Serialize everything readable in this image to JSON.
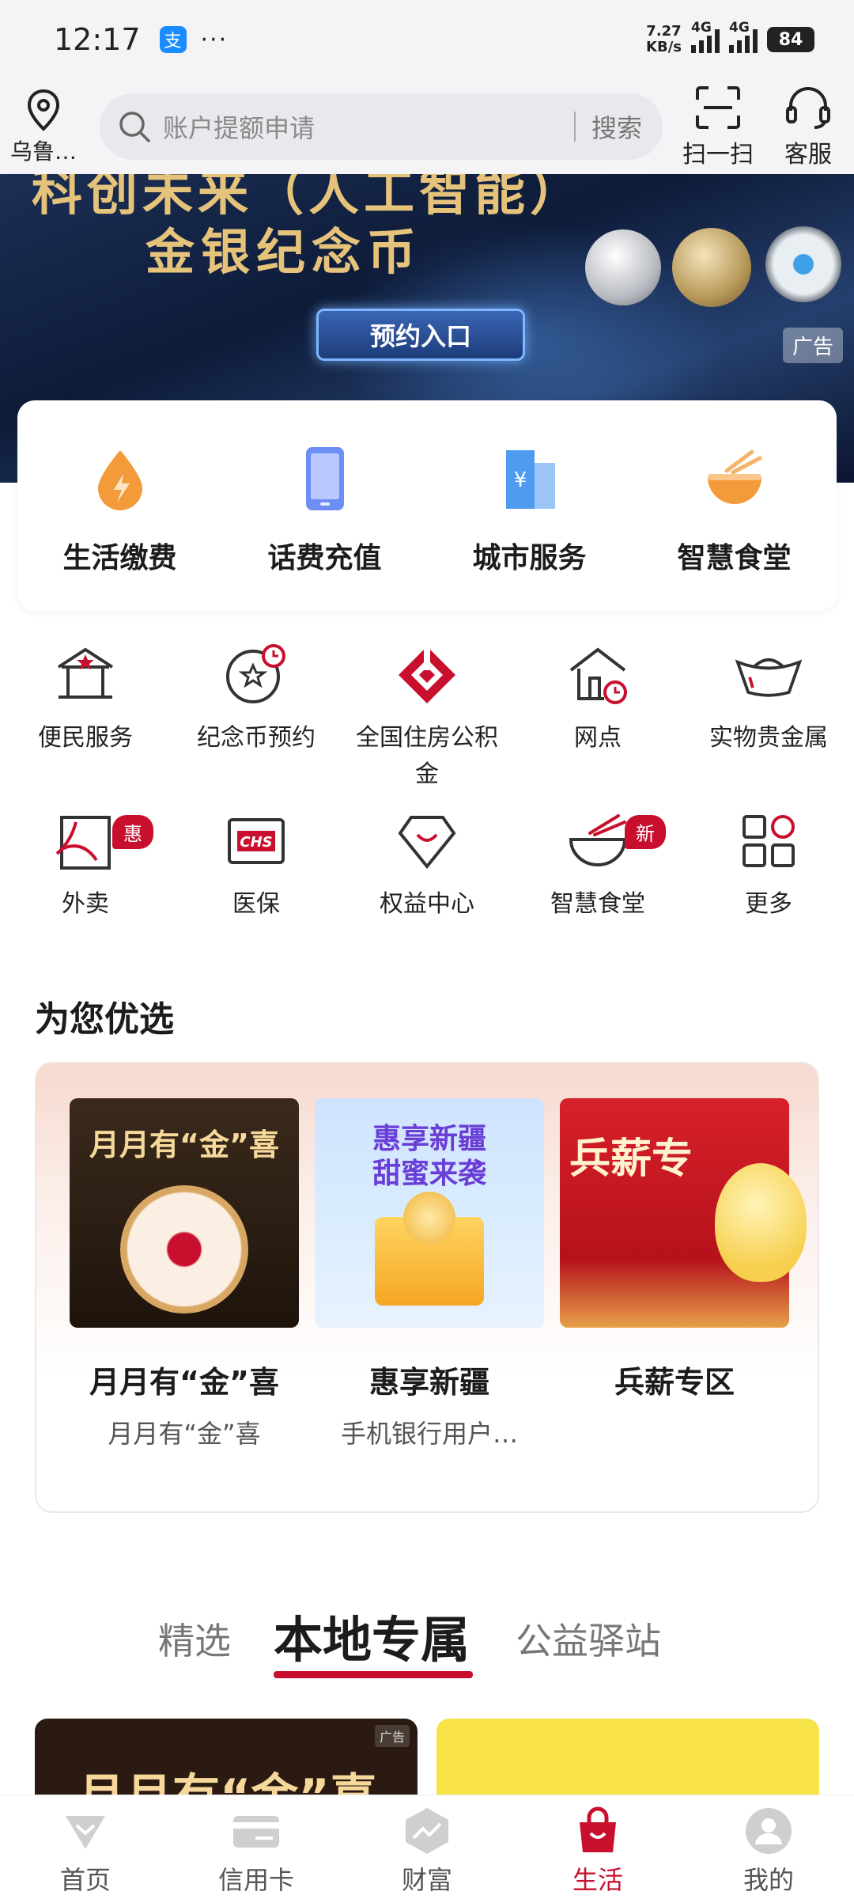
{
  "status_bar": {
    "time": "12:17",
    "app_badge": "支",
    "more": "···",
    "net_speed_value": "7.27",
    "net_speed_unit": "KB/s",
    "network1": "4G",
    "network2": "4G",
    "battery": "84"
  },
  "header": {
    "location": "乌鲁…",
    "search_placeholder": "账户提额申请",
    "search_button": "搜索",
    "scan_label": "扫一扫",
    "service_label": "客服"
  },
  "banner": {
    "title_line1": "科创未来（人工智能）",
    "title_line2": "金银纪念币",
    "cta": "预约入口",
    "ad_tag": "广告"
  },
  "life_services": [
    {
      "label": "生活缴费",
      "icon": "flame-drop-icon"
    },
    {
      "label": "话费充值",
      "icon": "phone-icon"
    },
    {
      "label": "城市服务",
      "icon": "city-building-icon"
    },
    {
      "label": "智慧食堂",
      "icon": "bowl-icon"
    }
  ],
  "grid": {
    "row1": [
      {
        "label": "便民服务",
        "icon": "bank-building-icon"
      },
      {
        "label": "纪念币预约",
        "icon": "coin-clock-icon"
      },
      {
        "label": "全国住房公积金",
        "icon": "housing-fund-logo-icon"
      },
      {
        "label": "网点",
        "icon": "branch-clock-icon"
      },
      {
        "label": "实物贵金属",
        "icon": "gold-ingot-icon"
      }
    ],
    "row2": [
      {
        "label": "外卖",
        "icon": "takeout-icon",
        "badge": "惠"
      },
      {
        "label": "医保",
        "icon": "chs-medical-icon"
      },
      {
        "label": "权益中心",
        "icon": "diamond-smile-icon"
      },
      {
        "label": "智慧食堂",
        "icon": "noodle-bowl-icon",
        "badge": "新"
      },
      {
        "label": "更多",
        "icon": "grid-more-icon"
      }
    ]
  },
  "featured": {
    "section_title": "为您优选",
    "items": [
      {
        "title": "月月有“金”喜",
        "subtitle": "月月有“金”喜",
        "img_text": "月月有“金”喜"
      },
      {
        "title": "惠享新疆",
        "subtitle": "手机银行用户…",
        "img_text_1": "惠享新疆",
        "img_text_2": "甜蜜来袭"
      },
      {
        "title": "兵薪专区",
        "subtitle": "",
        "img_text": "兵薪专"
      }
    ]
  },
  "tabs": {
    "items": [
      "精选",
      "本地专属",
      "公益驿站"
    ],
    "active": "本地专属"
  },
  "bottom_cards": {
    "left_text": "月月有“金”喜",
    "left_ad_tag": "广告"
  },
  "tabbar": [
    {
      "label": "首页",
      "icon": "home-icon"
    },
    {
      "label": "信用卡",
      "icon": "credit-card-icon"
    },
    {
      "label": "财富",
      "icon": "wealth-chart-icon"
    },
    {
      "label": "生活",
      "icon": "shopping-bag-icon",
      "active": true
    },
    {
      "label": "我的",
      "icon": "profile-icon"
    }
  ],
  "colors": {
    "brand_red": "#c8102e",
    "orange": "#f39a3a",
    "blue": "#5b8ff0"
  }
}
